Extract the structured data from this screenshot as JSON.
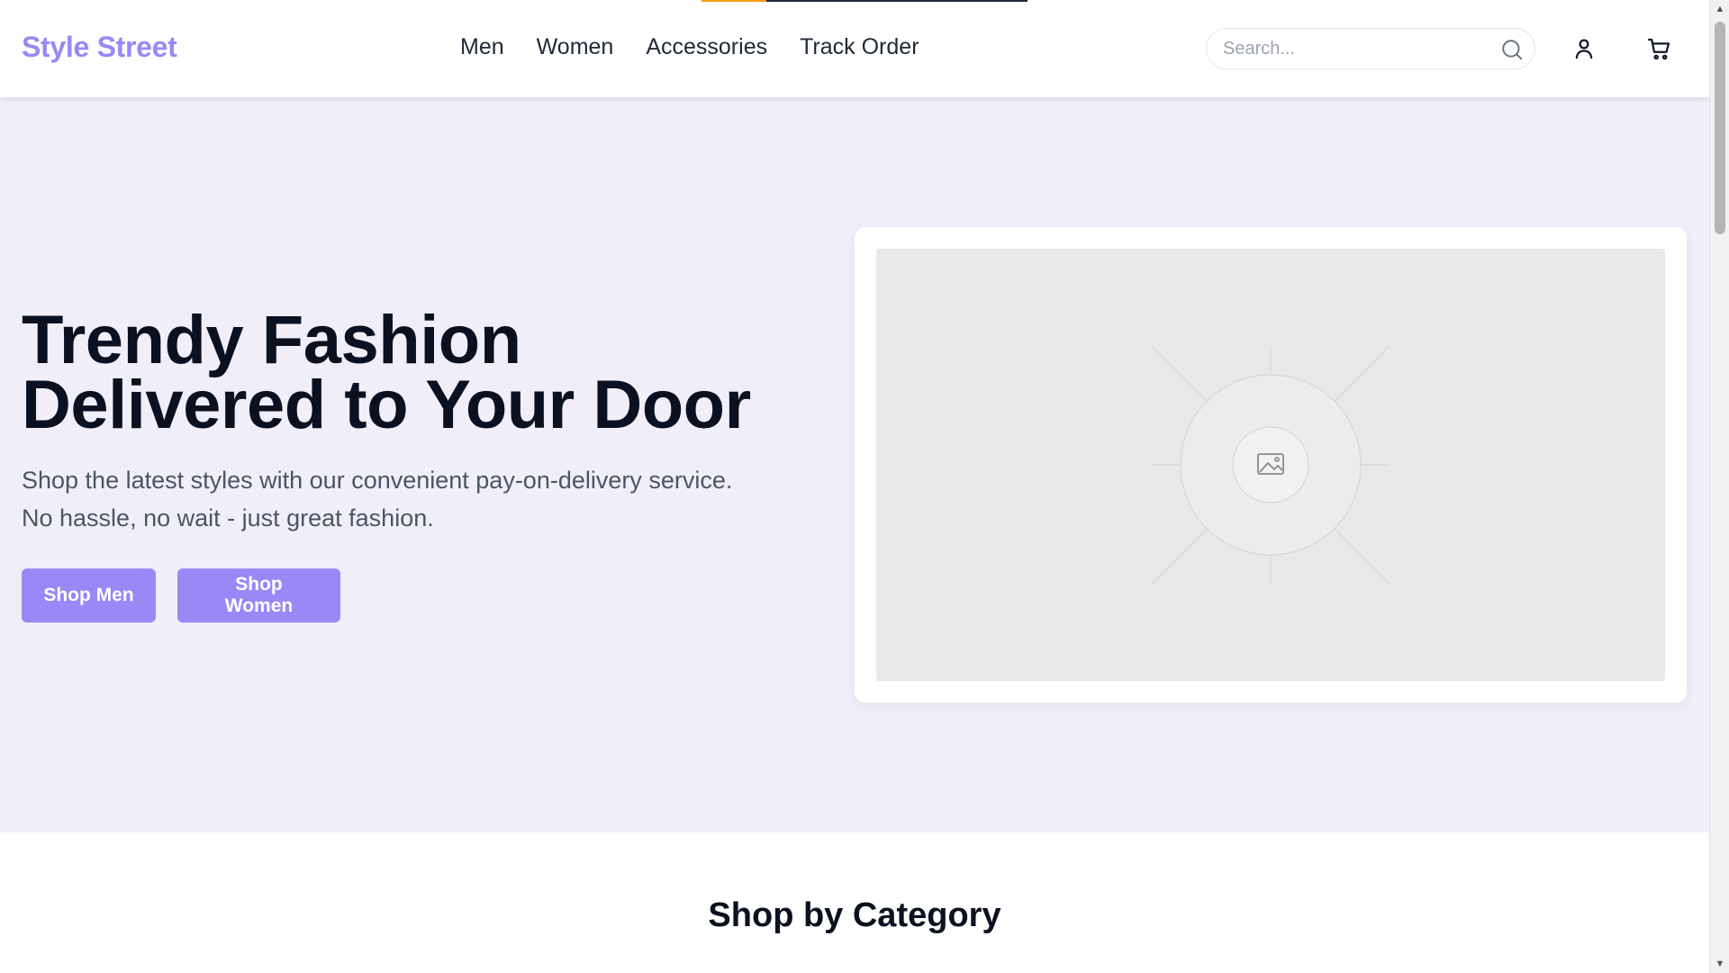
{
  "header": {
    "logo": "Style Street",
    "nav": [
      "Men",
      "Women",
      "Accessories",
      "Track Order"
    ],
    "search_placeholder": "Search...",
    "brand_color": "#9b87f5"
  },
  "icons": {
    "search": "search-icon",
    "user": "user-icon",
    "cart": "cart-icon",
    "image": "image-placeholder-icon"
  },
  "hero": {
    "title_line1": "Trendy Fashion",
    "title_line2": "Delivered to Your Door",
    "subtitle_line1": "Shop the latest styles with our convenient pay-on-delivery service.",
    "subtitle_line2": "No hassle, no wait - just great fashion.",
    "buttons": [
      "Shop Men",
      "Shop Women"
    ]
  },
  "categories": {
    "title": "Shop by Category"
  }
}
